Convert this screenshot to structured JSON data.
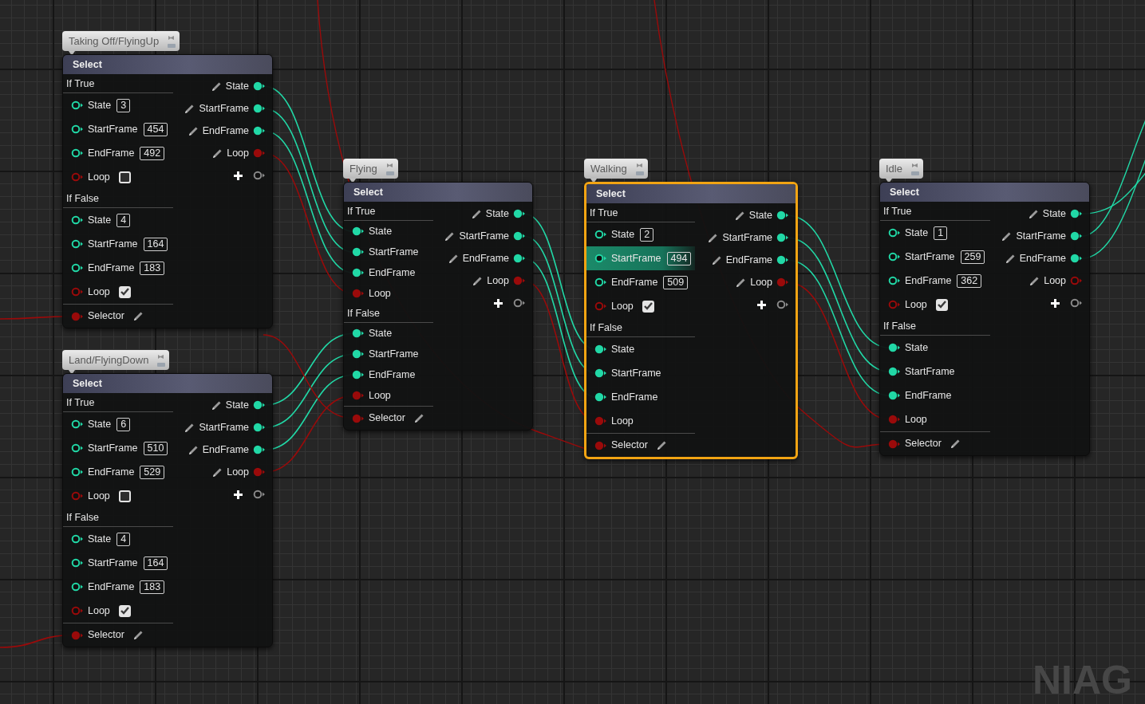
{
  "graph": {
    "corner_label": "NIAG",
    "nodes": [
      {
        "comment": "Taking Off/FlyingUp",
        "title": "Select",
        "selected": false,
        "inputs": [
          {
            "group": "If True",
            "pins": [
              {
                "label": "State",
                "kind": "number",
                "connected": false,
                "value": "3",
                "highlighted": false
              },
              {
                "label": "StartFrame",
                "kind": "number",
                "connected": false,
                "value": "454",
                "highlighted": false
              },
              {
                "label": "EndFrame",
                "kind": "number",
                "connected": false,
                "value": "492",
                "highlighted": false
              },
              {
                "label": "Loop",
                "kind": "toggle",
                "connected": false,
                "checked": false,
                "highlighted": false
              }
            ]
          },
          {
            "group": "If False",
            "pins": [
              {
                "label": "State",
                "kind": "number",
                "connected": false,
                "value": "4",
                "highlighted": false
              },
              {
                "label": "StartFrame",
                "kind": "number",
                "connected": false,
                "value": "164",
                "highlighted": false
              },
              {
                "label": "EndFrame",
                "kind": "number",
                "connected": false,
                "value": "183",
                "highlighted": false
              },
              {
                "label": "Loop",
                "kind": "toggle",
                "connected": false,
                "checked": true,
                "highlighted": false
              }
            ]
          }
        ],
        "selector": {
          "label": "Selector",
          "connected": true
        },
        "outputs": [
          {
            "label": "State",
            "kind": "number",
            "connected": true
          },
          {
            "label": "StartFrame",
            "kind": "number",
            "connected": true
          },
          {
            "label": "EndFrame",
            "kind": "number",
            "connected": true
          },
          {
            "label": "Loop",
            "kind": "toggle",
            "connected": true
          }
        ]
      },
      {
        "comment": "Land/FlyingDown",
        "title": "Select",
        "selected": false,
        "inputs": [
          {
            "group": "If True",
            "pins": [
              {
                "label": "State",
                "kind": "number",
                "connected": false,
                "value": "6",
                "highlighted": false
              },
              {
                "label": "StartFrame",
                "kind": "number",
                "connected": false,
                "value": "510",
                "highlighted": false
              },
              {
                "label": "EndFrame",
                "kind": "number",
                "connected": false,
                "value": "529",
                "highlighted": false
              },
              {
                "label": "Loop",
                "kind": "toggle",
                "connected": false,
                "checked": false,
                "highlighted": false
              }
            ]
          },
          {
            "group": "If False",
            "pins": [
              {
                "label": "State",
                "kind": "number",
                "connected": false,
                "value": "4",
                "highlighted": false
              },
              {
                "label": "StartFrame",
                "kind": "number",
                "connected": false,
                "value": "164",
                "highlighted": false
              },
              {
                "label": "EndFrame",
                "kind": "number",
                "connected": false,
                "value": "183",
                "highlighted": false
              },
              {
                "label": "Loop",
                "kind": "toggle",
                "connected": false,
                "checked": true,
                "highlighted": false
              }
            ]
          }
        ],
        "selector": {
          "label": "Selector",
          "connected": true
        },
        "outputs": [
          {
            "label": "State",
            "kind": "number",
            "connected": true
          },
          {
            "label": "StartFrame",
            "kind": "number",
            "connected": true
          },
          {
            "label": "EndFrame",
            "kind": "number",
            "connected": true
          },
          {
            "label": "Loop",
            "kind": "toggle",
            "connected": true
          }
        ]
      },
      {
        "comment": "Flying",
        "title": "Select",
        "selected": false,
        "inputs": [
          {
            "group": "If True",
            "pins": [
              {
                "label": "State",
                "kind": "number",
                "connected": true,
                "highlighted": false
              },
              {
                "label": "StartFrame",
                "kind": "number",
                "connected": true,
                "highlighted": false
              },
              {
                "label": "EndFrame",
                "kind": "number",
                "connected": true,
                "highlighted": false
              },
              {
                "label": "Loop",
                "kind": "toggle",
                "connected": true,
                "highlighted": false
              }
            ]
          },
          {
            "group": "If False",
            "pins": [
              {
                "label": "State",
                "kind": "number",
                "connected": true,
                "highlighted": false
              },
              {
                "label": "StartFrame",
                "kind": "number",
                "connected": true,
                "highlighted": false
              },
              {
                "label": "EndFrame",
                "kind": "number",
                "connected": true,
                "highlighted": false
              },
              {
                "label": "Loop",
                "kind": "toggle",
                "connected": true,
                "highlighted": false
              }
            ]
          }
        ],
        "selector": {
          "label": "Selector",
          "connected": true
        },
        "outputs": [
          {
            "label": "State",
            "kind": "number",
            "connected": true
          },
          {
            "label": "StartFrame",
            "kind": "number",
            "connected": true
          },
          {
            "label": "EndFrame",
            "kind": "number",
            "connected": true
          },
          {
            "label": "Loop",
            "kind": "toggle",
            "connected": true
          }
        ]
      },
      {
        "comment": "Walking",
        "title": "Select",
        "selected": true,
        "inputs": [
          {
            "group": "If True",
            "pins": [
              {
                "label": "State",
                "kind": "number",
                "connected": false,
                "value": "2",
                "highlighted": false
              },
              {
                "label": "StartFrame",
                "kind": "number",
                "connected": false,
                "value": "494",
                "highlighted": true
              },
              {
                "label": "EndFrame",
                "kind": "number",
                "connected": false,
                "value": "509",
                "highlighted": false
              },
              {
                "label": "Loop",
                "kind": "toggle",
                "connected": false,
                "checked": true,
                "highlighted": false
              }
            ]
          },
          {
            "group": "If False",
            "pins": [
              {
                "label": "State",
                "kind": "number",
                "connected": true,
                "highlighted": false
              },
              {
                "label": "StartFrame",
                "kind": "number",
                "connected": true,
                "highlighted": false
              },
              {
                "label": "EndFrame",
                "kind": "number",
                "connected": true,
                "highlighted": false
              },
              {
                "label": "Loop",
                "kind": "toggle",
                "connected": true,
                "highlighted": false
              }
            ]
          }
        ],
        "selector": {
          "label": "Selector",
          "connected": true
        },
        "outputs": [
          {
            "label": "State",
            "kind": "number",
            "connected": true
          },
          {
            "label": "StartFrame",
            "kind": "number",
            "connected": true
          },
          {
            "label": "EndFrame",
            "kind": "number",
            "connected": true
          },
          {
            "label": "Loop",
            "kind": "toggle",
            "connected": true
          }
        ]
      },
      {
        "comment": "Idle",
        "title": "Select",
        "selected": false,
        "inputs": [
          {
            "group": "If True",
            "pins": [
              {
                "label": "State",
                "kind": "number",
                "connected": false,
                "value": "1",
                "highlighted": false
              },
              {
                "label": "StartFrame",
                "kind": "number",
                "connected": false,
                "value": "259",
                "highlighted": false
              },
              {
                "label": "EndFrame",
                "kind": "number",
                "connected": false,
                "value": "362",
                "highlighted": false
              },
              {
                "label": "Loop",
                "kind": "toggle",
                "connected": false,
                "checked": true,
                "highlighted": false
              }
            ]
          },
          {
            "group": "If False",
            "pins": [
              {
                "label": "State",
                "kind": "number",
                "connected": true,
                "highlighted": false
              },
              {
                "label": "StartFrame",
                "kind": "number",
                "connected": true,
                "highlighted": false
              },
              {
                "label": "EndFrame",
                "kind": "number",
                "connected": true,
                "highlighted": false
              },
              {
                "label": "Loop",
                "kind": "toggle",
                "connected": true,
                "highlighted": false
              }
            ]
          }
        ],
        "selector": {
          "label": "Selector",
          "connected": true
        },
        "outputs": [
          {
            "label": "State",
            "kind": "number",
            "connected": true
          },
          {
            "label": "StartFrame",
            "kind": "number",
            "connected": true
          },
          {
            "label": "EndFrame",
            "kind": "number",
            "connected": true
          },
          {
            "label": "Loop",
            "kind": "toggle",
            "connected": false
          }
        ]
      }
    ]
  }
}
